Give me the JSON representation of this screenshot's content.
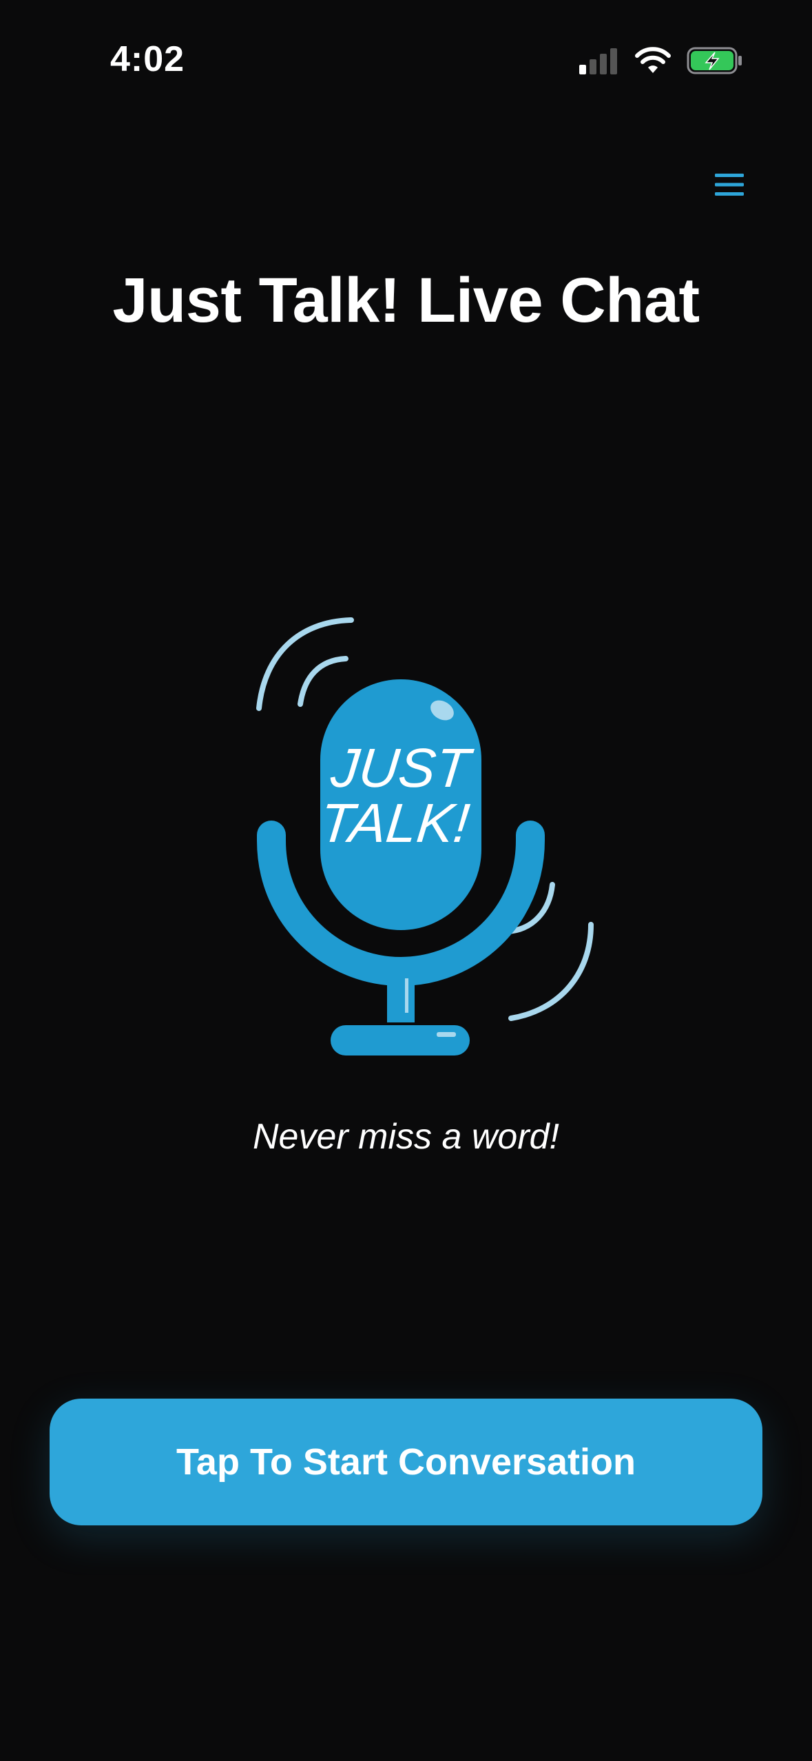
{
  "status_bar": {
    "time": "4:02",
    "icons": [
      "cellular-signal-icon",
      "wifi-icon",
      "battery-charging-icon"
    ]
  },
  "header": {
    "menu_icon": "hamburger-menu-icon",
    "title": "Just Talk! Live Chat"
  },
  "logo": {
    "icon": "microphone-logo-icon",
    "text_line1": "JUST",
    "text_line2": "TALK!"
  },
  "tagline": "Never miss a word!",
  "cta": {
    "label": "Tap To Start Conversation"
  },
  "colors": {
    "background": "#0a0a0b",
    "accent": "#2ea6da",
    "mic_blue": "#1f9bd1",
    "sound_wave": "#a9d8ee",
    "battery_green": "#34c759"
  }
}
